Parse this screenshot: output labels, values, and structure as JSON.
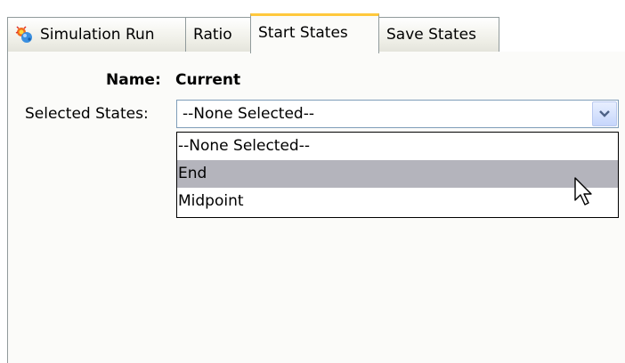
{
  "tabs": [
    {
      "label": "Simulation Run",
      "icon": "simulation-run-icon",
      "active": false
    },
    {
      "label": "Ratio",
      "active": false
    },
    {
      "label": "Start States",
      "active": true
    },
    {
      "label": "Save States",
      "active": false
    }
  ],
  "form": {
    "name_label": "Name:",
    "name_value": "Current",
    "selected_states_label": "Selected States:",
    "selected_states_value": "--None Selected--"
  },
  "dropdown": {
    "options": [
      "--None Selected--",
      "End",
      "Midpoint"
    ],
    "highlighted": "End"
  },
  "colors": {
    "active_tab_accent": "#ffc83c",
    "highlight": "#b4b4bc",
    "combo_border": "#7f9db9"
  }
}
